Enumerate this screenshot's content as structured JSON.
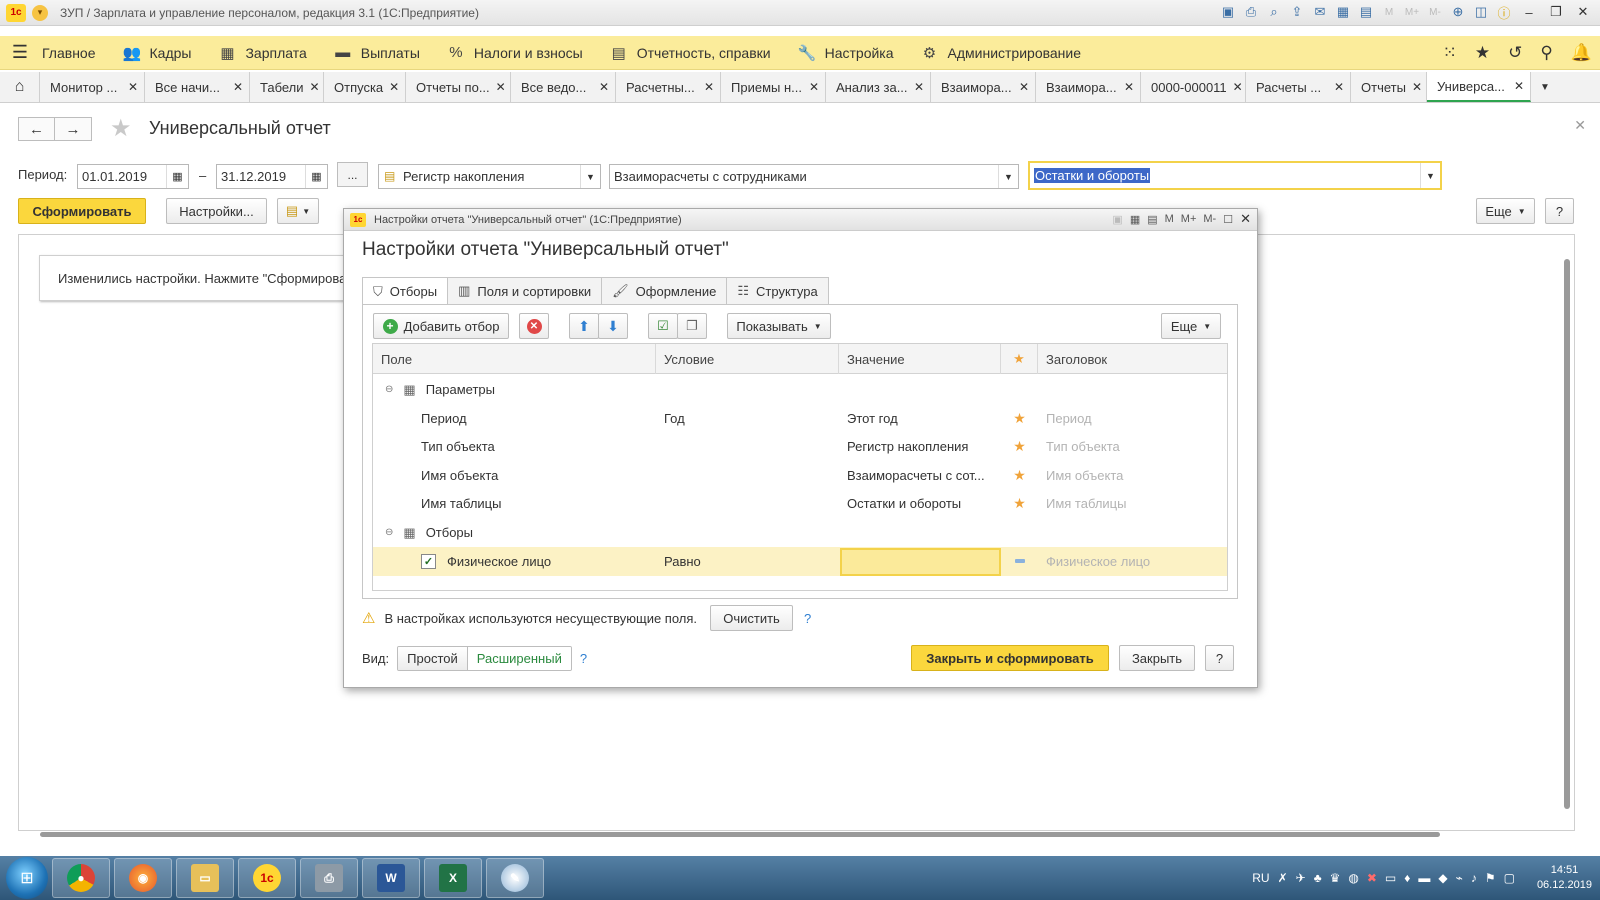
{
  "window": {
    "title": "ЗУП / Зарплата и управление персоналом, редакция 3.1  (1С:Предприятие)",
    "logo_text": "1с",
    "mem_labels": [
      "M",
      "M+",
      "M-"
    ]
  },
  "menu": {
    "items": [
      {
        "label": "Главное",
        "icon": "burger-icon"
      },
      {
        "label": "Кадры",
        "icon": "people-icon"
      },
      {
        "label": "Зарплата",
        "icon": "calculator-icon"
      },
      {
        "label": "Выплаты",
        "icon": "wallet-icon"
      },
      {
        "label": "Налоги и взносы",
        "icon": "percent-icon"
      },
      {
        "label": "Отчетность, справки",
        "icon": "report-icon"
      },
      {
        "label": "Настройка",
        "icon": "wrench-icon"
      },
      {
        "label": "Администрирование",
        "icon": "gear-icon"
      }
    ]
  },
  "tabs": [
    {
      "label": "Монитор ...",
      "w": 105
    },
    {
      "label": "Все начи...",
      "w": 105
    },
    {
      "label": "Табели",
      "w": 74
    },
    {
      "label": "Отпуска",
      "w": 82
    },
    {
      "label": "Отчеты по...",
      "w": 105
    },
    {
      "label": "Все ведо...",
      "w": 105
    },
    {
      "label": "Расчетны...",
      "w": 105
    },
    {
      "label": "Приемы н...",
      "w": 105
    },
    {
      "label": "Анализ за...",
      "w": 105
    },
    {
      "label": "Взаимора...",
      "w": 105
    },
    {
      "label": "Взаимора...",
      "w": 105
    },
    {
      "label": "0000-000011",
      "w": 105
    },
    {
      "label": "Расчеты ...",
      "w": 105
    },
    {
      "label": "Отчеты",
      "w": 76
    },
    {
      "label": "Универса...",
      "w": 104,
      "active": true
    }
  ],
  "page": {
    "title": "Универсальный отчет",
    "period_label": "Период:",
    "date_from": "01.01.2019",
    "date_to": "31.12.2019",
    "dash": "–",
    "dots": "...",
    "register_type": "Регистр накопления",
    "register_name": "Взаиморасчеты с сотрудниками",
    "table_name": "Остатки и обороты",
    "btn_generate": "Сформировать",
    "btn_settings": "Настройки...",
    "btn_more": "Еще",
    "btn_help": "?",
    "notice": "Изменились настройки. Нажмите \"Сформировать\""
  },
  "dialog": {
    "window_title": "Настройки отчета \"Универсальный отчет\"  (1С:Предприятие)",
    "heading": "Настройки отчета \"Универсальный отчет\"",
    "tabs": [
      {
        "label": "Отборы",
        "icon": "filter-icon",
        "active": true
      },
      {
        "label": "Поля и сортировки",
        "icon": "columns-icon"
      },
      {
        "label": "Оформление",
        "icon": "brush-icon"
      },
      {
        "label": "Структура",
        "icon": "structure-icon"
      }
    ],
    "toolbar": {
      "add_filter": "Добавить отбор",
      "show": "Показывать",
      "more": "Еще"
    },
    "columns": {
      "field": "Поле",
      "condition": "Условие",
      "value": "Значение",
      "title": "Заголовок"
    },
    "rows": [
      {
        "type": "group",
        "field": "Параметры",
        "condition": "",
        "value": "",
        "star": "",
        "title": ""
      },
      {
        "type": "item",
        "field": "Период",
        "condition": "Год",
        "value": "Этот год",
        "star": "★",
        "title": "Период"
      },
      {
        "type": "item",
        "field": "Тип объекта",
        "condition": "",
        "value": "Регистр накопления",
        "star": "★",
        "title": "Тип объекта"
      },
      {
        "type": "item",
        "field": "Имя объекта",
        "condition": "",
        "value": "Взаиморасчеты с сот...",
        "star": "★",
        "title": "Имя объекта"
      },
      {
        "type": "item",
        "field": "Имя таблицы",
        "condition": "",
        "value": "Остатки и обороты",
        "star": "★",
        "title": "Имя таблицы"
      },
      {
        "type": "group",
        "field": "Отборы",
        "condition": "",
        "value": "",
        "star": "",
        "title": ""
      },
      {
        "type": "filter",
        "checked": true,
        "field": "Физическое лицо",
        "condition": "Равно",
        "value": "",
        "star": "",
        "title": "Физическое лицо",
        "selected": true
      }
    ],
    "warning": "В настройках используются несуществующие поля.",
    "btn_clear": "Очистить",
    "help": "?",
    "view_label": "Вид:",
    "view_simple": "Простой",
    "view_extended": "Расширенный",
    "btn_close_generate": "Закрыть и сформировать",
    "btn_close": "Закрыть"
  },
  "taskbar": {
    "lang": "RU",
    "time": "14:51",
    "date": "06.12.2019"
  },
  "colors": {
    "menu_bg": "#fbec9b",
    "accent_yellow": "#fbd73d",
    "active_tab": "#2ea44f",
    "selection": "#3d68c8"
  }
}
